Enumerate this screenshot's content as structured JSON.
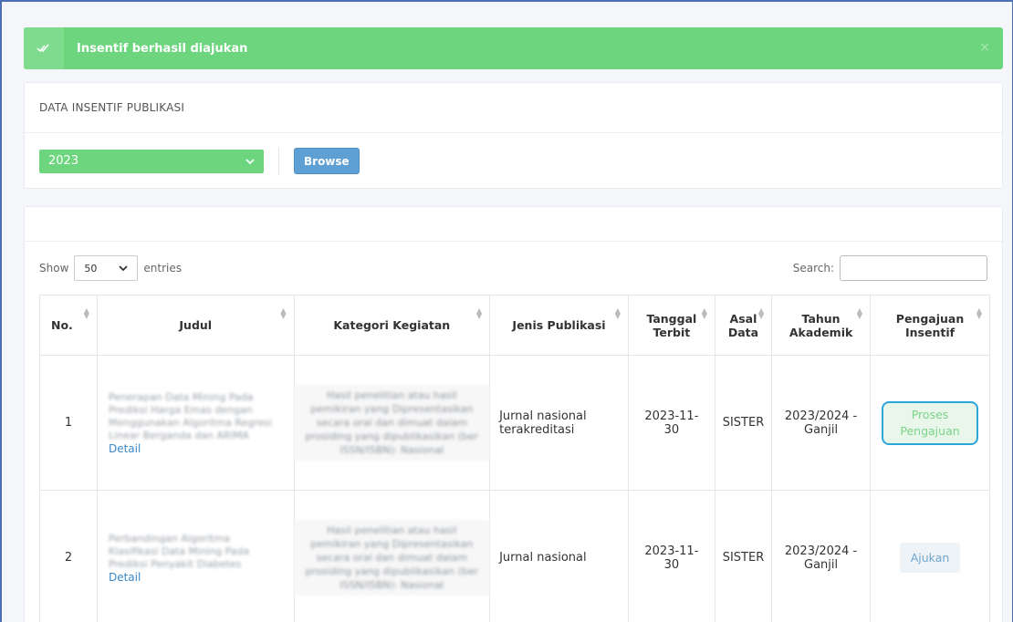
{
  "alert": {
    "message": "Insentif berhasil diajukan",
    "icon": "double-check-icon",
    "close": "×"
  },
  "filter_panel": {
    "title": "DATA INSENTIF PUBLIKASI",
    "year_value": "2023",
    "browse_label": "Browse"
  },
  "table_controls": {
    "show_label": "Show",
    "length_value": "50",
    "entries_label": "entries",
    "search_label": "Search:",
    "search_value": ""
  },
  "table": {
    "headers": {
      "no": "No.",
      "judul": "Judul",
      "kategori": "Kategori Kegiatan",
      "jenis": "Jenis Publikasi",
      "tanggal_1": "Tanggal",
      "tanggal_2": "Terbit",
      "asal_1": "Asal",
      "asal_2": "Data",
      "tahun_1": "Tahun",
      "tahun_2": "Akademik",
      "pengajuan_1": "Pengajuan",
      "pengajuan_2": "Insentif"
    },
    "rows": [
      {
        "no": "1",
        "judul_blurred": "Penerapan Data Mining Pada Prediksi Harga Emas dengan Menggunakan Algoritma Regresi Linear Berganda dan ARIMA",
        "detail": "Detail",
        "kategori_blurred": "Hasil penelitian atau hasil pemikiran yang Dipresentasikan secara oral dan dimuat dalam prosiding yang dipublikasikan (ber ISSN/ISBN): Nasional",
        "jenis_1": "Jurnal nasional",
        "jenis_2": "terakreditasi",
        "tanggal_1": "2023-11-",
        "tanggal_2": "30",
        "asal": "SISTER",
        "tahun_1": "2023/2024 -",
        "tahun_2": "Ganjil",
        "action_1": "Proses",
        "action_2": "Pengajuan"
      },
      {
        "no": "2",
        "judul_blurred": "Perbandingan Algoritma Klasifikasi Data Mining Pada Prediksi Penyakit Diabetes",
        "detail": "Detail",
        "kategori_blurred": "Hasil penelitian atau hasil pemikiran yang Dipresentasikan secara oral dan dimuat dalam prosiding yang dipublikasikan (ber ISSN/ISBN): Nasional",
        "jenis_1": "Jurnal nasional",
        "tanggal_1": "2023-11-",
        "tanggal_2": "30",
        "asal": "SISTER",
        "tahun_1": "2023/2024 -",
        "tahun_2": "Ganjil",
        "action": "Ajukan"
      }
    ]
  },
  "colors": {
    "success": "#6dd57e",
    "primary": "#5e9fd4",
    "highlight_border": "#2aa7d8"
  }
}
